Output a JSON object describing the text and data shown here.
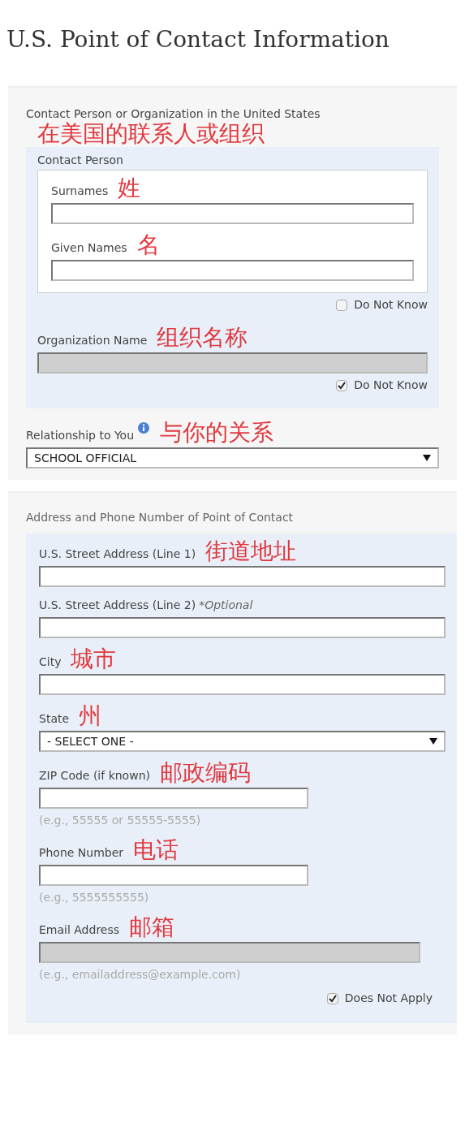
{
  "page_title": "U.S. Point of Contact Information",
  "contact_section": {
    "heading": "Contact Person or Organization in the United States",
    "annotation": "在美国的联系人或组织",
    "person_group": {
      "legend": "Contact Person",
      "fields": [
        {
          "label": "Surnames",
          "annotation": "姓"
        },
        {
          "label": "Given Names",
          "annotation": "名"
        }
      ],
      "do_not_know": {
        "label": "Do Not Know",
        "checked": false
      }
    },
    "organization": {
      "label": "Organization Name",
      "annotation": "组织名称",
      "disabled": true,
      "do_not_know": {
        "label": "Do Not Know",
        "checked": true
      }
    }
  },
  "relationship": {
    "label": "Relationship to You",
    "annotation": "与你的关系",
    "value": "SCHOOL OFFICIAL"
  },
  "address_section": {
    "heading": "Address and Phone Number of Point of Contact",
    "fields": [
      {
        "kind": "text",
        "label": "U.S. Street Address (Line 1)",
        "annotation": "街道地址"
      },
      {
        "kind": "text",
        "label": "U.S. Street Address (Line 2)",
        "note": "*Optional"
      },
      {
        "kind": "text",
        "label": "City",
        "annotation": "城市"
      },
      {
        "kind": "select",
        "label": "State",
        "annotation": "州",
        "value": "- SELECT ONE -"
      },
      {
        "kind": "short_text",
        "label": "ZIP Code (if known)",
        "annotation": "邮政编码",
        "hint": "(e.g., 55555 or 55555-5555)"
      },
      {
        "kind": "short_text",
        "label": "Phone Number",
        "annotation": "电话",
        "hint": "(e.g., 5555555555)"
      },
      {
        "kind": "text",
        "label": "Email Address",
        "annotation": "邮箱",
        "disabled": true,
        "hint": "(e.g., emailaddress@example.com)",
        "checkbox": {
          "label": "Does Not Apply",
          "checked": true
        }
      }
    ]
  }
}
